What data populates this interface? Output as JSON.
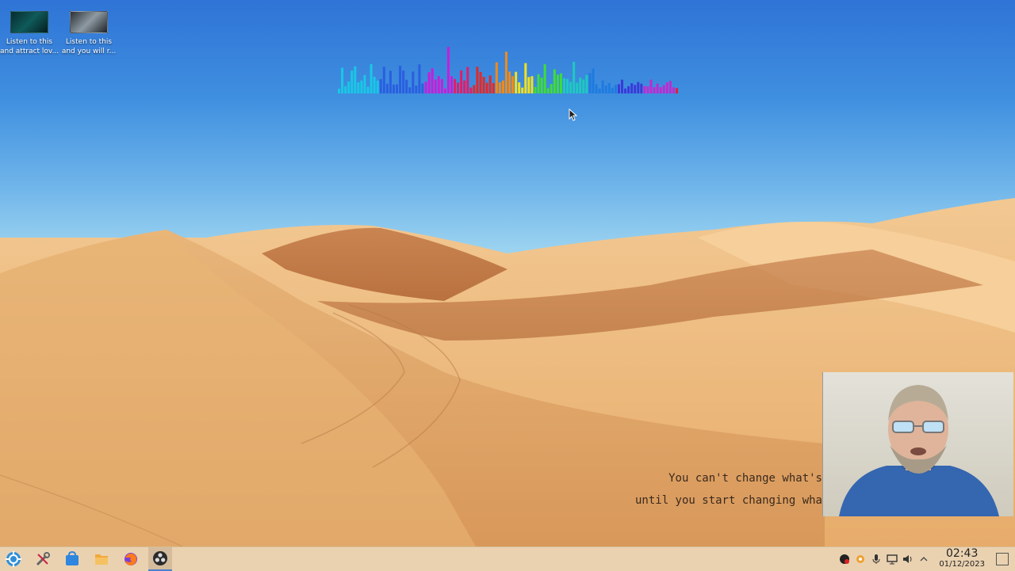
{
  "desktop": {
    "icons": [
      {
        "label_line1": "Listen to this",
        "label_line2": "and attract lov..."
      },
      {
        "label_line1": "Listen to this",
        "label_line2": "and you will r..."
      }
    ],
    "quote": {
      "line1": "You can't change what's",
      "line2": "until you start changing wha"
    }
  },
  "taskbar": {
    "launchers": [
      {
        "icon": "app-launcher-icon"
      },
      {
        "icon": "system-settings-icon"
      },
      {
        "icon": "discover-store-icon"
      },
      {
        "icon": "file-manager-icon"
      },
      {
        "icon": "firefox-icon"
      },
      {
        "icon": "obs-studio-icon"
      }
    ],
    "tray": {
      "icons": [
        "obs-tray-icon",
        "notifications-icon",
        "microphone-icon",
        "network-icon",
        "volume-icon",
        "expand-tray-icon"
      ],
      "time": "02:43",
      "date": "01/12/2023"
    }
  },
  "colors": {
    "taskbar_bg": "#ead2b1",
    "sky_top": "#2f74d6",
    "sand": "#e2a868"
  }
}
